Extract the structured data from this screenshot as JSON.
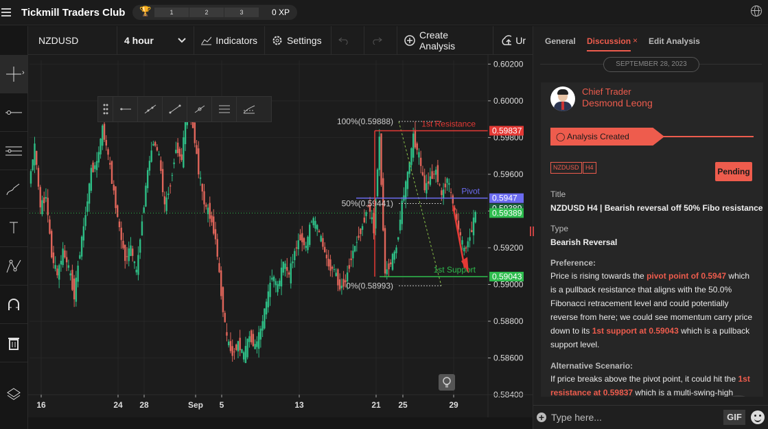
{
  "app": {
    "title": "Tickmill Traders Club",
    "xp_levels": [
      "1",
      "2",
      "3"
    ],
    "xp": "0 XP"
  },
  "toolbar": {
    "symbol": "NZDUSD",
    "timeframe": "4 hour",
    "indicators": "Indicators",
    "settings": "Settings",
    "create_analysis": "Create Analysis",
    "upload": "Ur"
  },
  "left_tools": [
    "crosshair-icon",
    "trend-line-icon",
    "horizontal-lines-icon",
    "brush-icon",
    "text-icon",
    "pattern-icon",
    "magnet-icon",
    "trash-icon",
    "layers-icon"
  ],
  "draw_tools": [
    "horizontal-ray-icon",
    "extended-line-icon",
    "segment-icon",
    "info-line-icon",
    "parallel-channel-icon",
    "fib-channel-icon"
  ],
  "chart_data": {
    "type": "candlestick",
    "symbol": "NZDUSD",
    "timeframe": "4 hour",
    "x_ticks": [
      "16",
      "24",
      "28",
      "Sep",
      "5",
      "13",
      "21",
      "25",
      "29"
    ],
    "y_ticks": [
      "0.60200",
      "0.60000",
      "0.59800",
      "0.59600",
      "0.59400",
      "0.59200",
      "0.59000",
      "0.58800",
      "0.58600",
      "0.58400"
    ],
    "ylim": [
      0.584,
      0.6022
    ],
    "close_path": [
      [
        0,
        0.5955
      ],
      [
        3,
        0.5975
      ],
      [
        6,
        0.5942
      ],
      [
        9,
        0.5948
      ],
      [
        12,
        0.5916
      ],
      [
        15,
        0.5905
      ],
      [
        18,
        0.5918
      ],
      [
        21,
        0.5909
      ],
      [
        24,
        0.5894
      ],
      [
        27,
        0.5918
      ],
      [
        30,
        0.5938
      ],
      [
        33,
        0.5962
      ],
      [
        36,
        0.5966
      ],
      [
        39,
        0.5985
      ],
      [
        42,
        0.597
      ],
      [
        45,
        0.595
      ],
      [
        48,
        0.593
      ],
      [
        51,
        0.5914
      ],
      [
        54,
        0.592
      ],
      [
        57,
        0.5906
      ],
      [
        60,
        0.5935
      ],
      [
        63,
        0.5962
      ],
      [
        66,
        0.5978
      ],
      [
        69,
        0.597
      ],
      [
        72,
        0.5942
      ],
      [
        75,
        0.5955
      ],
      [
        78,
        0.5975
      ],
      [
        81,
        0.5968
      ],
      [
        84,
        0.5998
      ],
      [
        87,
        0.5986
      ],
      [
        90,
        0.5962
      ],
      [
        93,
        0.5944
      ],
      [
        96,
        0.5938
      ],
      [
        99,
        0.5925
      ],
      [
        102,
        0.5895
      ],
      [
        105,
        0.587
      ],
      [
        108,
        0.5862
      ],
      [
        111,
        0.5868
      ],
      [
        114,
        0.5861
      ],
      [
        117,
        0.5872
      ],
      [
        120,
        0.5866
      ],
      [
        123,
        0.5875
      ],
      [
        126,
        0.589
      ],
      [
        129,
        0.5905
      ],
      [
        132,
        0.5898
      ],
      [
        135,
        0.5912
      ],
      [
        138,
        0.5905
      ],
      [
        141,
        0.5918
      ],
      [
        144,
        0.5926
      ],
      [
        147,
        0.592
      ],
      [
        150,
        0.5936
      ],
      [
        153,
        0.5931
      ],
      [
        156,
        0.5921
      ],
      [
        159,
        0.591
      ],
      [
        162,
        0.5908
      ],
      [
        165,
        0.5898
      ],
      [
        168,
        0.5902
      ],
      [
        171,
        0.5915
      ],
      [
        174,
        0.5924
      ],
      [
        177,
        0.5932
      ],
      [
        180,
        0.5944
      ],
      [
        183,
        0.593
      ],
      [
        186,
        0.598
      ],
      [
        189,
        0.5906
      ],
      [
        192,
        0.5912
      ],
      [
        195,
        0.592
      ],
      [
        198,
        0.5944
      ],
      [
        201,
        0.596
      ],
      [
        204,
        0.598
      ],
      [
        207,
        0.597
      ],
      [
        210,
        0.5952
      ],
      [
        213,
        0.5958
      ],
      [
        216,
        0.5962
      ],
      [
        219,
        0.5948
      ],
      [
        222,
        0.5958
      ],
      [
        225,
        0.5944
      ],
      [
        228,
        0.593
      ],
      [
        231,
        0.5918
      ],
      [
        234,
        0.5926
      ],
      [
        237,
        0.5939
      ]
    ],
    "fibonacci": [
      {
        "label": "100%(0.59888)",
        "level": 0.59888
      },
      {
        "label": "50%(0.59441)",
        "level": 0.59441
      },
      {
        "label": "0%(0.58993)",
        "level": 0.58993
      }
    ],
    "levels": [
      {
        "name": "1st Resistance",
        "value": 0.59837,
        "tag": "0.59837",
        "color": "#e53935"
      },
      {
        "name": "Pivot",
        "value": 0.5947,
        "tag": "0.5947",
        "color": "#6b6bf0"
      },
      {
        "name": "1st Support",
        "value": 0.59043,
        "tag": "0.59043",
        "color": "#2ebd4e"
      }
    ],
    "current_price": {
      "value": 0.59389,
      "tag": "0.59389",
      "color": "#2ebd4e"
    },
    "hidden_price_tag": "0.59389",
    "colors": {
      "up": "#2ebd85",
      "down": "#e0655a"
    }
  },
  "panel": {
    "tabs": [
      "General",
      "Discussion",
      "Edit Analysis"
    ],
    "date": "SEPTEMBER 28, 2023",
    "role": "Chief Trader",
    "author": "Desmond Leong",
    "ribbon": "Analysis Created",
    "tags": [
      "NZDUSD",
      "H4"
    ],
    "status": "Pending",
    "title_label": "Title",
    "title": "NZDUSD H4 | Bearish reversal off 50% Fibo resistance",
    "type_label": "Type",
    "type": "Bearish Reversal",
    "pref_label": "Preference:",
    "pref_1": "Price is rising towards the ",
    "pref_hl1": "pivot point of 0.5947",
    "pref_2": " which is a pullback resistance that aligns with the 50.0% Fibonacci retracement level and could potentially reverse from here; we could see momentum carry price down to its ",
    "pref_hl2": "1st support at 0.59043",
    "pref_3": " which is a pullback support level.",
    "alt_label": "Alternative Scenario:",
    "alt_1": "If price breaks above the pivot point, it could hit the ",
    "alt_hl1": "1st resistance at 0.59837",
    "alt_2": " which is a multi-swing-high",
    "composer_placeholder": "Type here...",
    "gif": "GIF"
  }
}
